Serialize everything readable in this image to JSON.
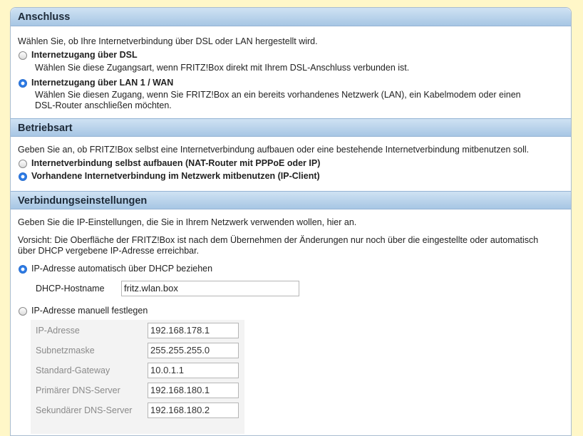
{
  "anschluss": {
    "header": "Anschluss",
    "intro": "Wählen Sie, ob Ihre Internetverbindung über DSL oder LAN hergestellt wird.",
    "options": [
      {
        "label": "Internetzugang über DSL",
        "desc1": "Wählen Sie diese Zugangsart, wenn FRITZ!Box direkt mit Ihrem DSL-Anschluss verbunden ist.",
        "selected": false
      },
      {
        "label": "Internetzugang über LAN 1 / WAN",
        "desc1": "Wählen Sie diesen Zugang, wenn Sie FRITZ!Box an ein bereits vorhandenes Netzwerk (LAN), ein Kabelmodem oder einen",
        "desc2": "DSL-Router anschließen möchten.",
        "selected": true
      }
    ]
  },
  "betriebsart": {
    "header": "Betriebsart",
    "intro": "Geben Sie an, ob FRITZ!Box selbst eine Internetverbindung aufbauen oder eine bestehende Internetverbindung mitbenutzen soll.",
    "options": [
      {
        "label": "Internetverbindung selbst aufbauen (NAT-Router mit PPPoE oder IP)",
        "selected": false
      },
      {
        "label": "Vorhandene Internetverbindung im Netzwerk mitbenutzen (IP-Client)",
        "selected": true
      }
    ]
  },
  "verbindung": {
    "header": "Verbindungseinstellungen",
    "intro": "Geben Sie die IP-Einstellungen, die Sie in Ihrem Netzwerk verwenden wollen, hier an.",
    "warning1": "Vorsicht: Die Oberfläche der FRITZ!Box ist nach dem Übernehmen der Änderungen nur noch über die eingestellte oder automatisch",
    "warning2": "über DHCP vergebene IP-Adresse erreichbar.",
    "dhcp": {
      "label": "IP-Adresse automatisch über DHCP beziehen",
      "selected": true,
      "hostname_label": "DHCP-Hostname",
      "hostname_value": "fritz.wlan.box"
    },
    "manual": {
      "label": "IP-Adresse manuell festlegen",
      "selected": false,
      "fields": [
        {
          "label": "IP-Adresse",
          "value": "192.168.178.1"
        },
        {
          "label": "Subnetzmaske",
          "value": "255.255.255.0"
        },
        {
          "label": "Standard-Gateway",
          "value": "10.0.1.1"
        },
        {
          "label": "Primärer DNS-Server",
          "value": "192.168.180.1"
        },
        {
          "label": "Sekundärer DNS-Server",
          "value": "192.168.180.2"
        }
      ]
    }
  }
}
